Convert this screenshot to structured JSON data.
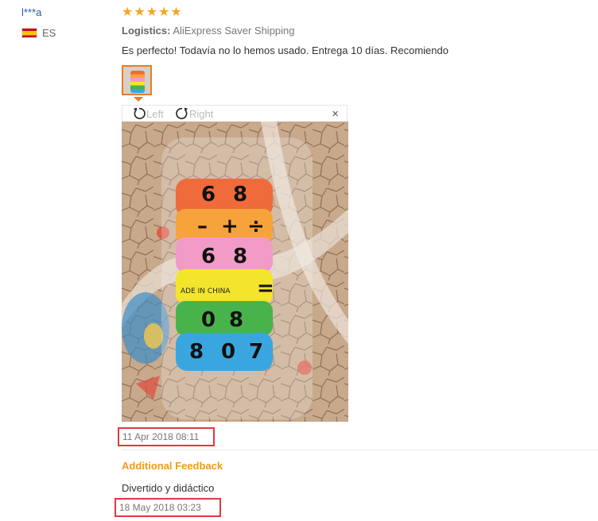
{
  "user": {
    "name": "l***a",
    "country": "ES"
  },
  "review": {
    "stars": [
      "★",
      "★",
      "★",
      "★",
      "★"
    ],
    "logistics_label": "Logistics:",
    "logistics_value": "AliExpress Saver Shipping",
    "text": "Es perfecto! Todavía no lo hemos usado. Entrega 10 días. Recomiendo",
    "date": "11 Apr 2018 08:11"
  },
  "viewer": {
    "rotate_left": "Left",
    "rotate_right": "Right",
    "close": "×"
  },
  "photo": {
    "label": "ADE IN CHINA"
  },
  "additional": {
    "title": "Additional Feedback",
    "text": "Divertido y didáctico",
    "date": "18 May 2018 03:23"
  },
  "colors": {
    "accent": "#f39c12",
    "highlight": "#e0383e",
    "link": "#2255aa"
  }
}
